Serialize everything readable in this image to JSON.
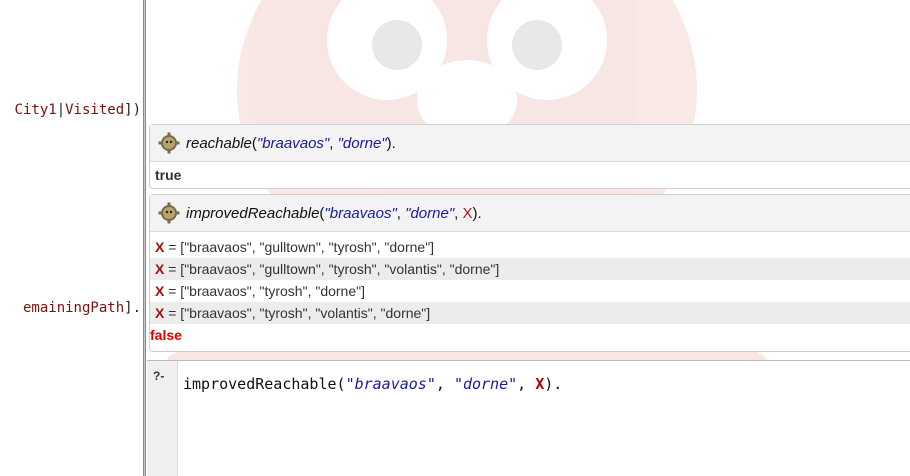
{
  "editor": {
    "line1": {
      "text": "City1",
      "sep": "|",
      "text2": "Visited",
      "end": "])"
    },
    "line2": {
      "text": "emainingPath",
      "end": "]."
    }
  },
  "query1": {
    "functor": "reachable",
    "arg1": "\"braavaos\"",
    "arg2": "\"dorne\"",
    "close": ").",
    "answer": "true"
  },
  "query2": {
    "functor": "improvedReachable",
    "arg1": "\"braavaos\"",
    "arg2": "\"dorne\"",
    "arg3": "X",
    "close": ").",
    "rows": [
      {
        "var": "X",
        "value": " = [\"braavaos\", \"gulltown\", \"tyrosh\", \"dorne\"]"
      },
      {
        "var": "X",
        "value": " = [\"braavaos\", \"gulltown\", \"tyrosh\", \"volantis\", \"dorne\"]"
      },
      {
        "var": "X",
        "value": " = [\"braavaos\", \"tyrosh\", \"dorne\"]"
      },
      {
        "var": "X",
        "value": " = [\"braavaos\", \"tyrosh\", \"volantis\", \"dorne\"]"
      }
    ],
    "final": "false"
  },
  "input": {
    "prompt": "?-",
    "functor": "improvedReachable",
    "open": "(",
    "arg1": "\"braavaos\"",
    "comma": ", ",
    "arg2": "\"dorne\"",
    "arg3": "X",
    "close": ")."
  },
  "icons": {
    "query": "swi-prolog-gear-icon"
  }
}
